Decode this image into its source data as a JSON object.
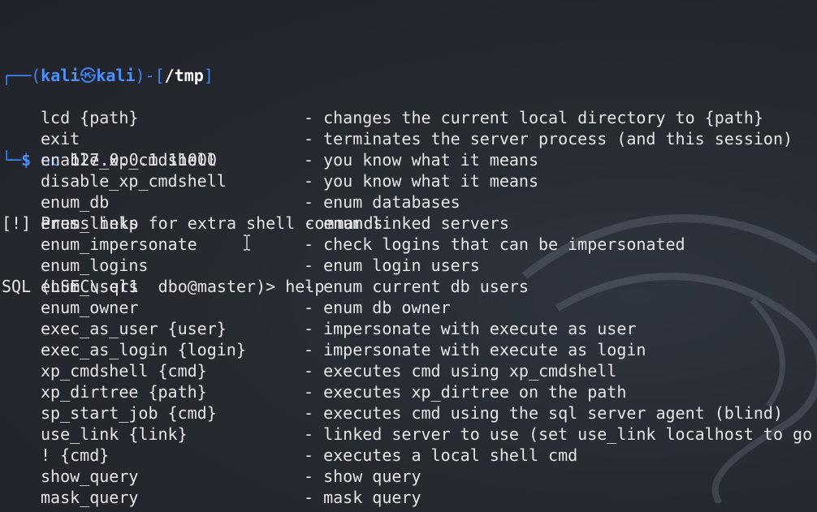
{
  "prompt": {
    "corner_top": "┌──(",
    "user": "kali",
    "at_symbol": "㉿",
    "host": "kali",
    "dir_open": ")-[",
    "cwd": "/tmp",
    "dir_close": "]",
    "corner_bottom": "└─",
    "dollar": "$",
    "command_prog": "nc",
    "command_args": " 127.0.0.1 11000"
  },
  "output": {
    "notice": "[!] Press help for extra shell commands",
    "sql_prompt": "SQL (LSEC\\sql1  dbo@master)> help"
  },
  "help_items": [
    {
      "cmd": "lcd {path}",
      "desc": "- changes the current local directory to {path}"
    },
    {
      "cmd": "exit",
      "desc": "- terminates the server process (and this session)"
    },
    {
      "cmd": "enable_xp_cmdshell",
      "desc": "- you know what it means"
    },
    {
      "cmd": "disable_xp_cmdshell",
      "desc": "- you know what it means"
    },
    {
      "cmd": "enum_db",
      "desc": "- enum databases"
    },
    {
      "cmd": "enum_links",
      "desc": "- enum linked servers"
    },
    {
      "cmd": "enum_impersonate",
      "desc": "- check logins that can be impersonated"
    },
    {
      "cmd": "enum_logins",
      "desc": "- enum login users"
    },
    {
      "cmd": "enum_users",
      "desc": "- enum current db users"
    },
    {
      "cmd": "enum_owner",
      "desc": "- enum db owner"
    },
    {
      "cmd": "exec_as_user {user}",
      "desc": "- impersonate with execute as user"
    },
    {
      "cmd": "exec_as_login {login}",
      "desc": "- impersonate with execute as login"
    },
    {
      "cmd": "xp_cmdshell {cmd}",
      "desc": "- executes cmd using xp_cmdshell"
    },
    {
      "cmd": "xp_dirtree {path}",
      "desc": "- executes xp_dirtree on the path"
    },
    {
      "cmd": "sp_start_job {cmd}",
      "desc": "- executes cmd using the sql server agent (blind)"
    },
    {
      "cmd": "use_link {link}",
      "desc": "- linked server to use (set use_link localhost to go"
    },
    {
      "cmd": "! {cmd}",
      "desc": "- executes a local shell cmd"
    },
    {
      "cmd": "show_query",
      "desc": "- show query"
    },
    {
      "cmd": "mask_query",
      "desc": "- mask query"
    }
  ],
  "colors": {
    "prompt_blue": "#3f82f3",
    "text": "#e6e6e6",
    "background": "#23262d"
  },
  "icons": {
    "background_logo": "kali-dragon-icon",
    "mouse_cursor": "text-cursor-icon"
  }
}
